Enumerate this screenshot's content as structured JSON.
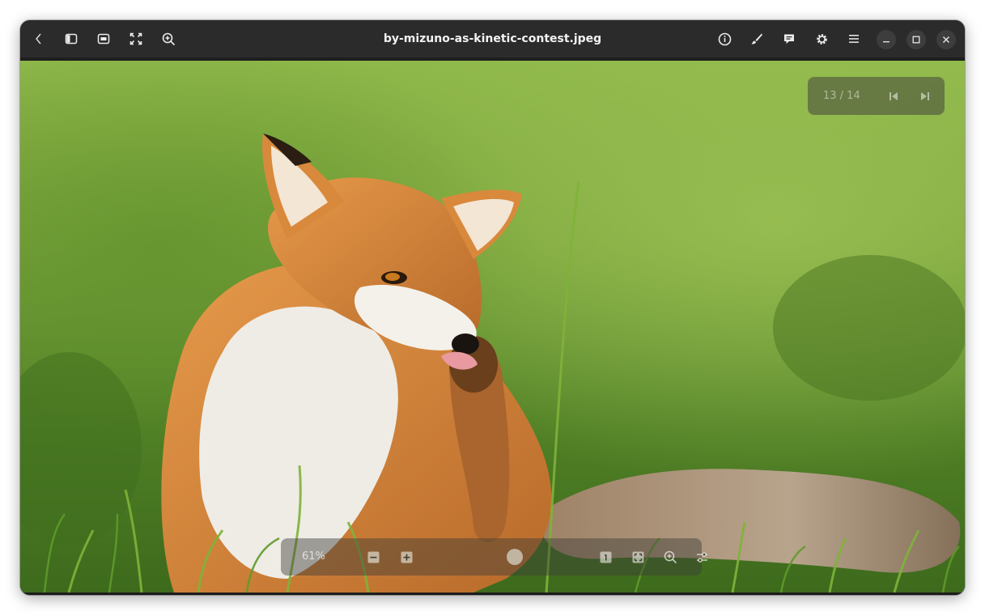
{
  "window": {
    "title": "by-mizuno-as-kinetic-contest.jpeg"
  },
  "header": {
    "left_icons": [
      "back-chevron-icon",
      "sidebar-toggle-icon",
      "fit-window-icon",
      "fullscreen-icon",
      "zoom-in-icon"
    ],
    "right_icons": [
      "info-icon",
      "edit-brush-icon",
      "comment-icon",
      "settings-gear-icon",
      "hamburger-menu-icon"
    ],
    "window_controls": [
      "minimize",
      "maximize",
      "close"
    ]
  },
  "navigation": {
    "counter": "13 / 14",
    "icons": [
      "previous-icon",
      "next-icon"
    ]
  },
  "zoom_bar": {
    "zoom_level": "61%",
    "zoom_fraction": 0.61,
    "icons": [
      "zoom-out-icon",
      "zoom-in-small-icon",
      "zoom-slider",
      "actual-size-icon",
      "fit-icon",
      "magnifier-icon",
      "adjust-icon"
    ]
  },
  "image": {
    "subject": "fox photograph"
  },
  "colors": {
    "titlebar": "#2b2b2b",
    "window_frame": "#242424",
    "text": "#f2f2f2",
    "overlay": "rgba(60,60,55,0.45)"
  }
}
